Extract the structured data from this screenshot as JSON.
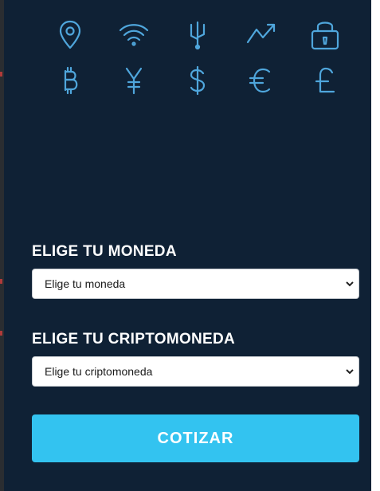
{
  "colors": {
    "panel_bg": "#0f2135",
    "icon_color": "#4fa6dc",
    "button_bg": "#33c3f0",
    "button_text": "#ffffff",
    "label_text": "#ffffff"
  },
  "icons": {
    "row1": [
      "location-pin-icon",
      "wifi-icon",
      "usb-icon",
      "trend-up-icon",
      "padlock-icon"
    ],
    "row2": [
      "bitcoin-icon",
      "yen-icon",
      "dollar-icon",
      "euro-icon",
      "pound-icon"
    ]
  },
  "form": {
    "currency_label": "ELIGE TU MONEDA",
    "currency_selected": "Elige tu moneda",
    "crypto_label": "ELIGE TU CRIPTOMONEDA",
    "crypto_selected": "Elige tu criptomoneda",
    "submit_label": "COTIZAR"
  }
}
